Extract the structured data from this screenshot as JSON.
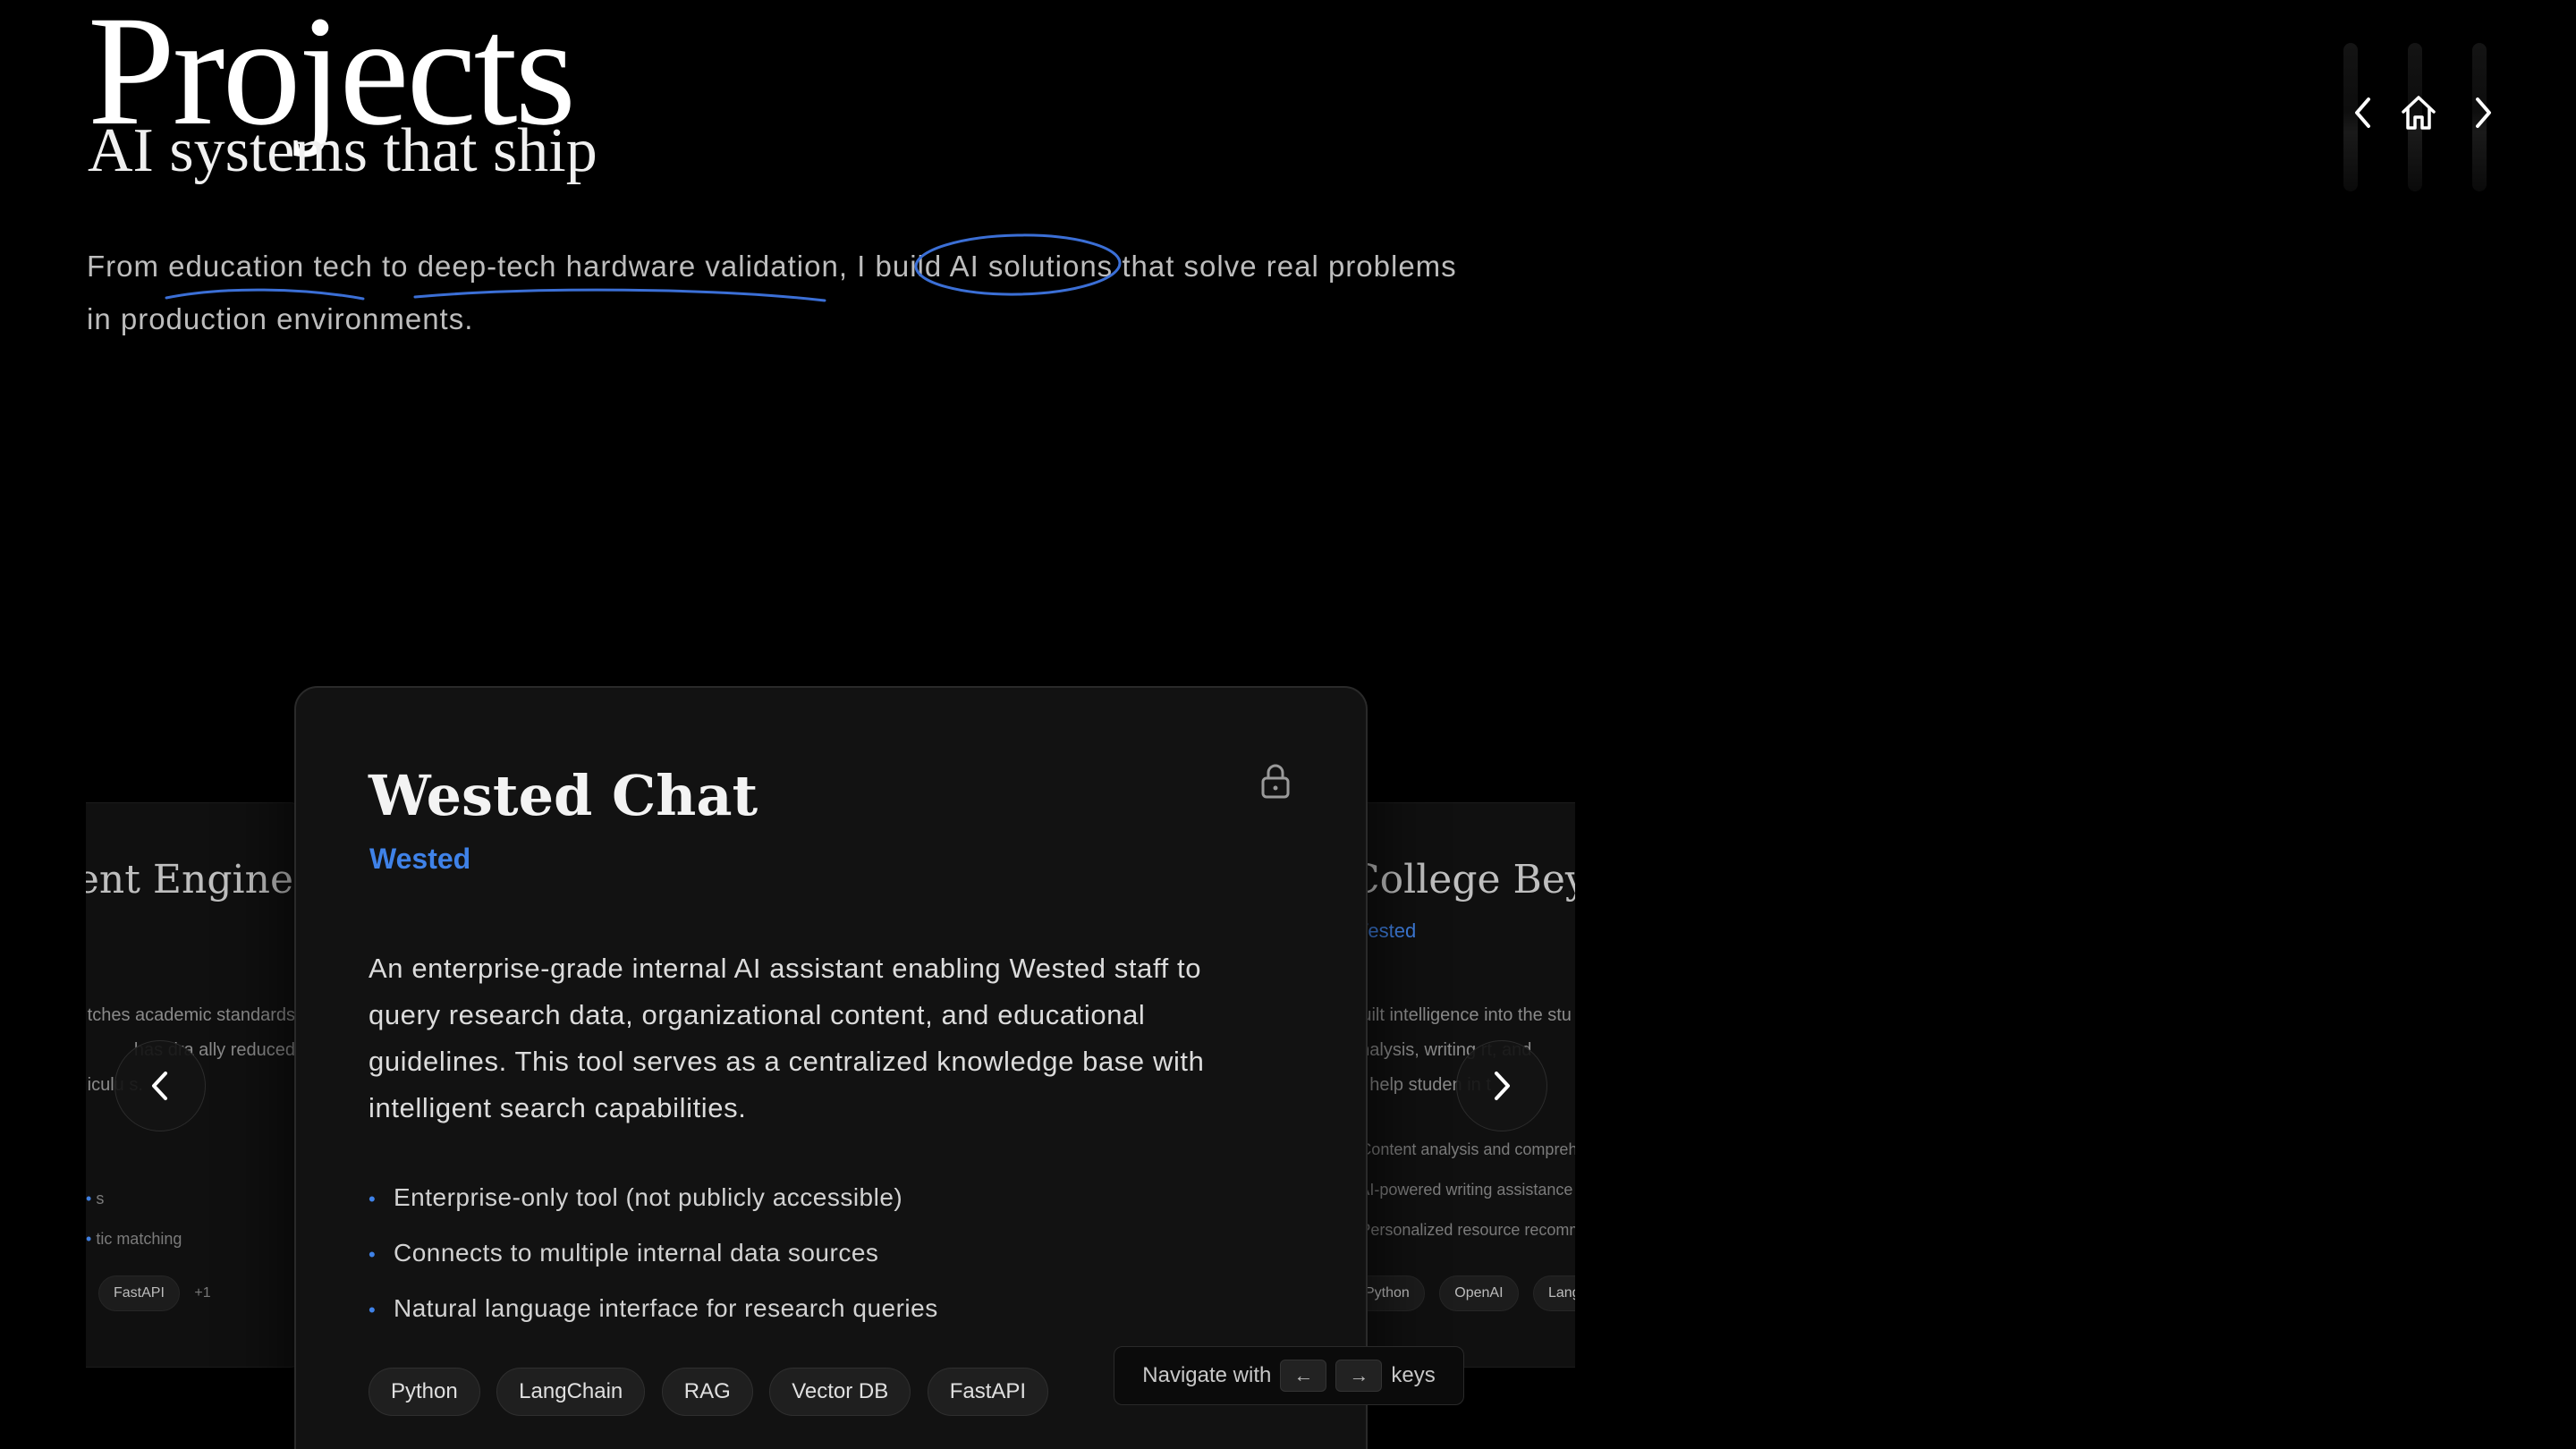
{
  "header": {
    "title": "Projects",
    "subtitle": "AI systems that ship",
    "intro_line1_parts": [
      "From ",
      "education tech",
      " to ",
      "deep-tech hardware validation",
      ", I build ",
      "AI solutions",
      " that solve real problems"
    ],
    "intro_line2": "in production environments."
  },
  "top_nav": {
    "prev_icon": "chevron-left-icon",
    "home_icon": "home-icon",
    "next_icon": "chevron-right-icon"
  },
  "cards": {
    "left": {
      "title": "ent Engine",
      "desc_lines": [
        "tches academic standards",
        "has dra  ally reduced",
        "iculu  s."
      ],
      "bullets": [
        "s",
        "tic matching"
      ],
      "tags": [
        "FastAPI"
      ],
      "more": "+1"
    },
    "main": {
      "title": "Wested Chat",
      "org": "Wested",
      "description": "An enterprise-grade internal AI assistant enabling Wested staff to query research data, organizational content, and educational guidelines. This tool serves as a centralized knowledge base with intelligent search capabilities.",
      "bullets": [
        "Enterprise-only tool (not publicly accessible)",
        "Connects to multiple internal data sources",
        "Natural language interface for research queries"
      ],
      "tags": [
        "Python",
        "LangChain",
        "RAG",
        "Vector DB",
        "FastAPI"
      ],
      "lock_icon": "lock-icon"
    },
    "right": {
      "title": "College Beyon",
      "org": "Wested",
      "desc_lines": [
        "Built intelligence into the stu",
        "analysis, writing    rt, and",
        "to help studen    in t"
      ],
      "bullets": [
        "Content analysis and compreh",
        "AI-powered writing assistance",
        "Personalized resource recomm"
      ],
      "tags": [
        "Python",
        "OpenAI",
        "LangCh"
      ]
    }
  },
  "hint": {
    "prefix": "Navigate with",
    "left_key": "←",
    "right_key": "→",
    "suffix": "keys"
  },
  "colors": {
    "accent": "#3f82e8",
    "background": "#000000",
    "card": "#121212"
  }
}
